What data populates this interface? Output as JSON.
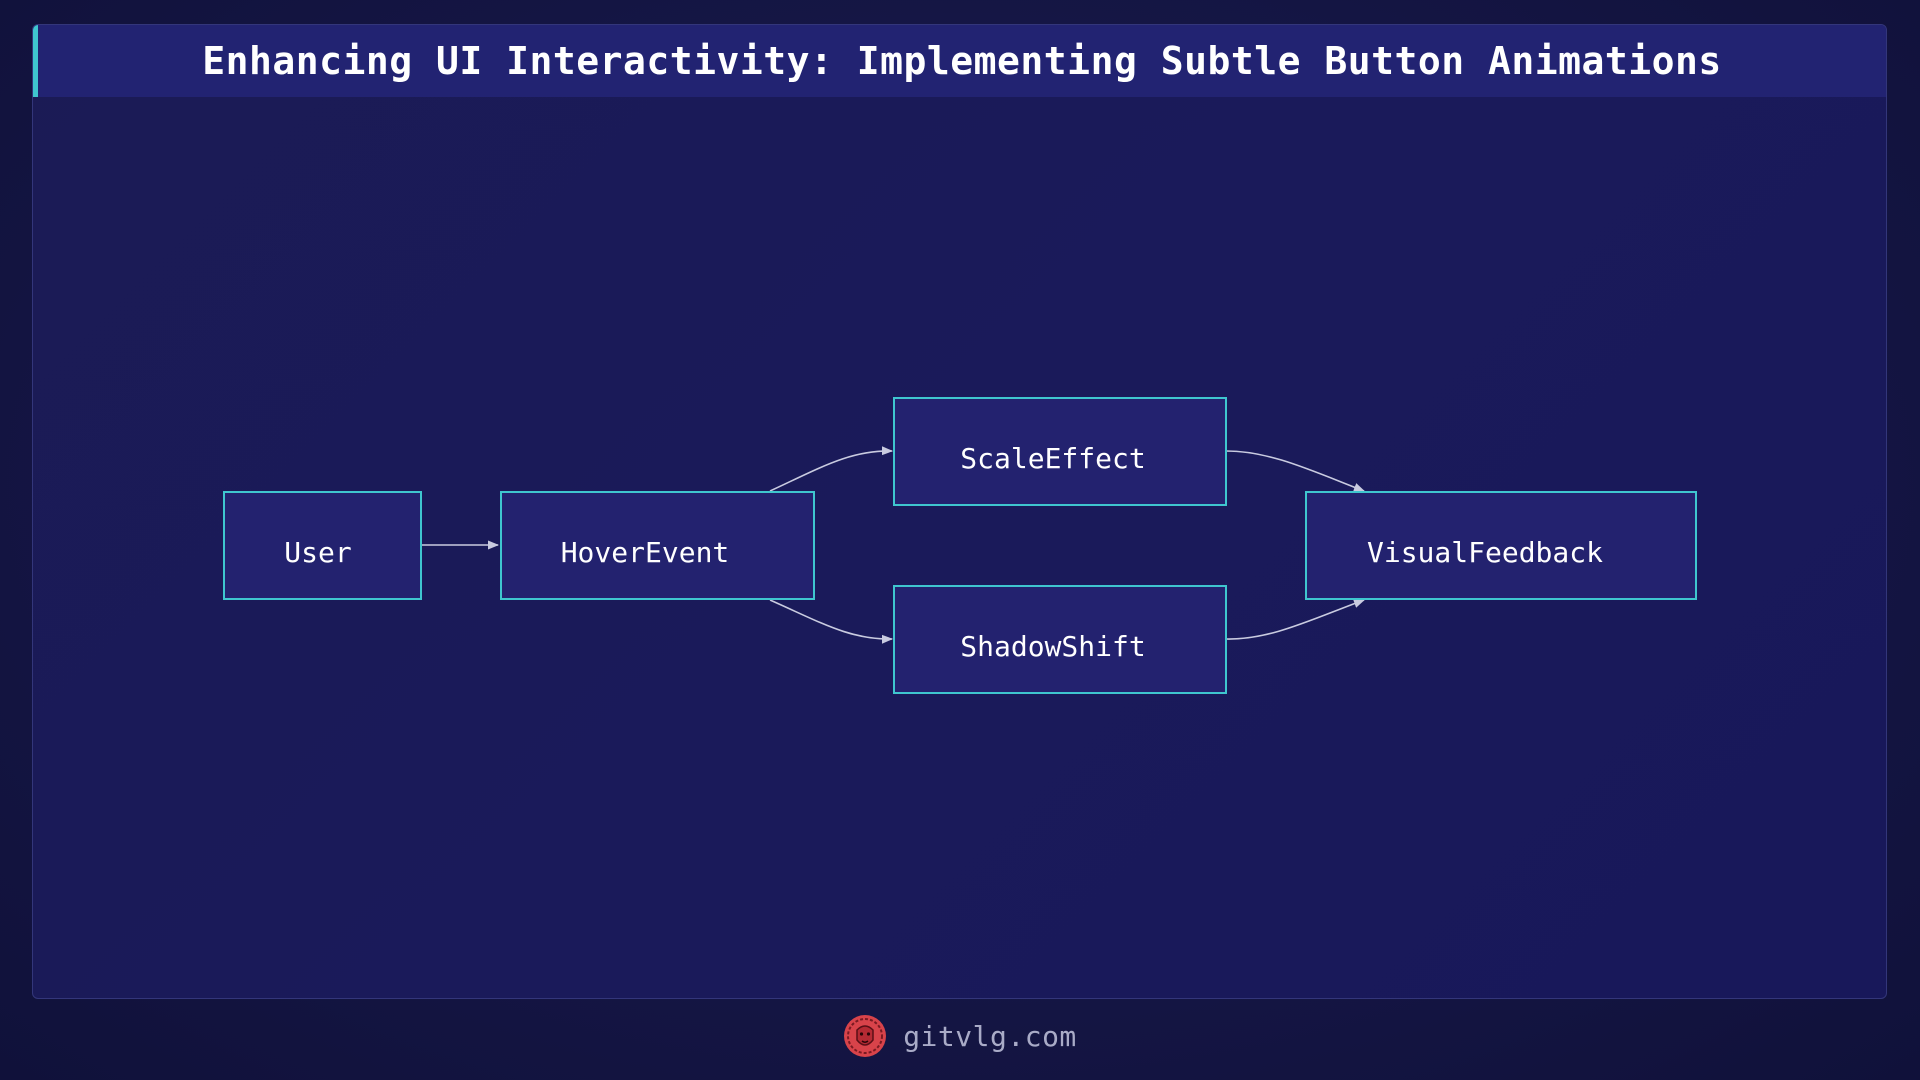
{
  "header": {
    "title": "Enhancing UI Interactivity: Implementing Subtle Button Animations"
  },
  "diagram": {
    "nodes": {
      "user": "User",
      "hover_event": "HoverEvent",
      "scale_effect": "ScaleEffect",
      "shadow_shift": "ShadowShift",
      "visual_feedback": "VisualFeedback"
    },
    "edges": [
      {
        "from": "User",
        "to": "HoverEvent"
      },
      {
        "from": "HoverEvent",
        "to": "ScaleEffect"
      },
      {
        "from": "HoverEvent",
        "to": "ShadowShift"
      },
      {
        "from": "ScaleEffect",
        "to": "VisualFeedback"
      },
      {
        "from": "ShadowShift",
        "to": "VisualFeedback"
      }
    ]
  },
  "footer": {
    "site": "gitvlg.com",
    "logo_icon": "lion-head-icon"
  },
  "colors": {
    "background": "#151645",
    "title_bar": "#222372",
    "accent": "#3fc6cf",
    "node_fill": "#23226f",
    "edge": "#c9cbe0",
    "logo": "#d8434a"
  }
}
